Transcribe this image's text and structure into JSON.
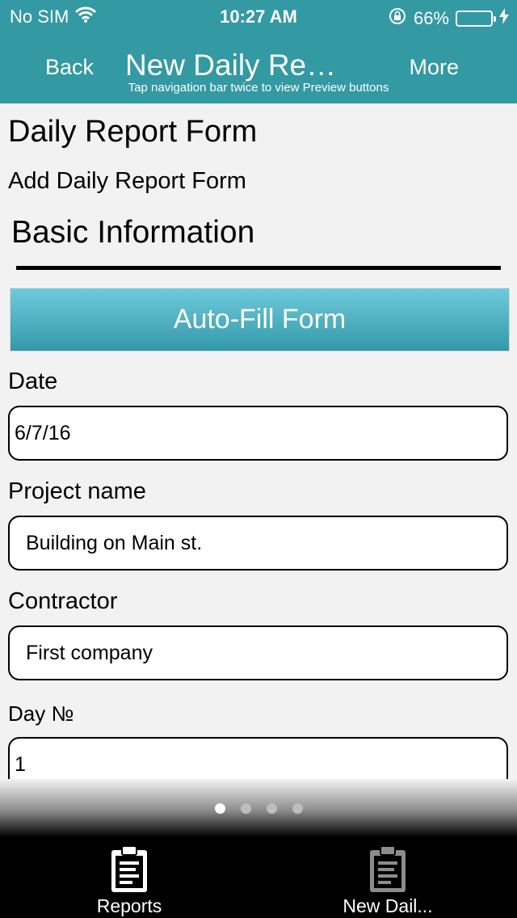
{
  "status_bar": {
    "carrier": "No SIM",
    "time": "10:27 AM",
    "battery_percent": "66%",
    "battery_level": 0.66,
    "battery_color": "#5fd35f"
  },
  "nav": {
    "back_label": "Back",
    "title": "New Daily Re…",
    "more_label": "More",
    "hint": "Tap navigation bar twice to view Preview buttons",
    "bar_color": "#3399a3"
  },
  "form": {
    "title": "Daily Report Form",
    "subtitle": "Add Daily Report Form",
    "section_title": "Basic Information",
    "autofill_label": "Auto-Fill Form",
    "fields": [
      {
        "label": "Date",
        "value": "6/7/16"
      },
      {
        "label": "Project name",
        "value": "Building on Main st."
      },
      {
        "label": "Contractor",
        "value": "First company"
      },
      {
        "label": "Day №",
        "value": "1"
      }
    ]
  },
  "pager": {
    "pages": 4,
    "active_index": 0
  },
  "tabs": [
    {
      "label": "Reports",
      "icon": "clipboard-icon",
      "active": true
    },
    {
      "label": "New Dail...",
      "icon": "clipboard-icon",
      "active": false
    }
  ]
}
